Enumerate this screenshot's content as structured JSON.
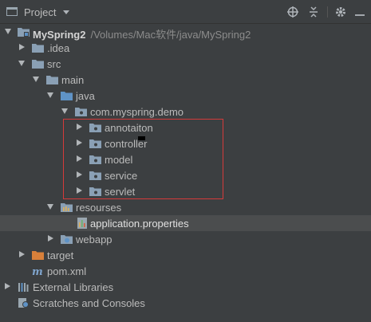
{
  "header": {
    "title": "Project",
    "icons": [
      "project-view-icon",
      "dropdown-chevron-icon",
      "locate-icon",
      "collapse-all-icon",
      "settings-gear-icon",
      "hide-panel-icon"
    ]
  },
  "tree": {
    "root": {
      "label": "MySpring2",
      "path": "/Volumes/Mac软件/java/MySpring2",
      "expanded": true
    },
    "idea": {
      "label": ".idea",
      "expanded": false
    },
    "src": {
      "label": "src",
      "expanded": true
    },
    "main": {
      "label": "main",
      "expanded": true
    },
    "java": {
      "label": "java",
      "expanded": true
    },
    "package": {
      "label": "com.myspring.demo",
      "expanded": true
    },
    "packages": [
      {
        "label": "annotaiton"
      },
      {
        "label": "controller"
      },
      {
        "label": "model"
      },
      {
        "label": "service"
      },
      {
        "label": "servlet"
      }
    ],
    "resources": {
      "label": "resourses",
      "expanded": true
    },
    "app_props": {
      "label": "application.properties"
    },
    "webapp": {
      "label": "webapp",
      "expanded": false
    },
    "target": {
      "label": "target",
      "expanded": false
    },
    "pom": {
      "label": "pom.xml"
    },
    "external": {
      "label": "External Libraries",
      "expanded": false
    },
    "scratches": {
      "label": "Scratches and Consoles"
    }
  },
  "colors": {
    "background": "#3c3f41",
    "selection": "#4b4d4e",
    "highlight_box": "#d43a3a",
    "folder_blue": "#6f9cc4",
    "folder_orange": "#d8803a"
  }
}
